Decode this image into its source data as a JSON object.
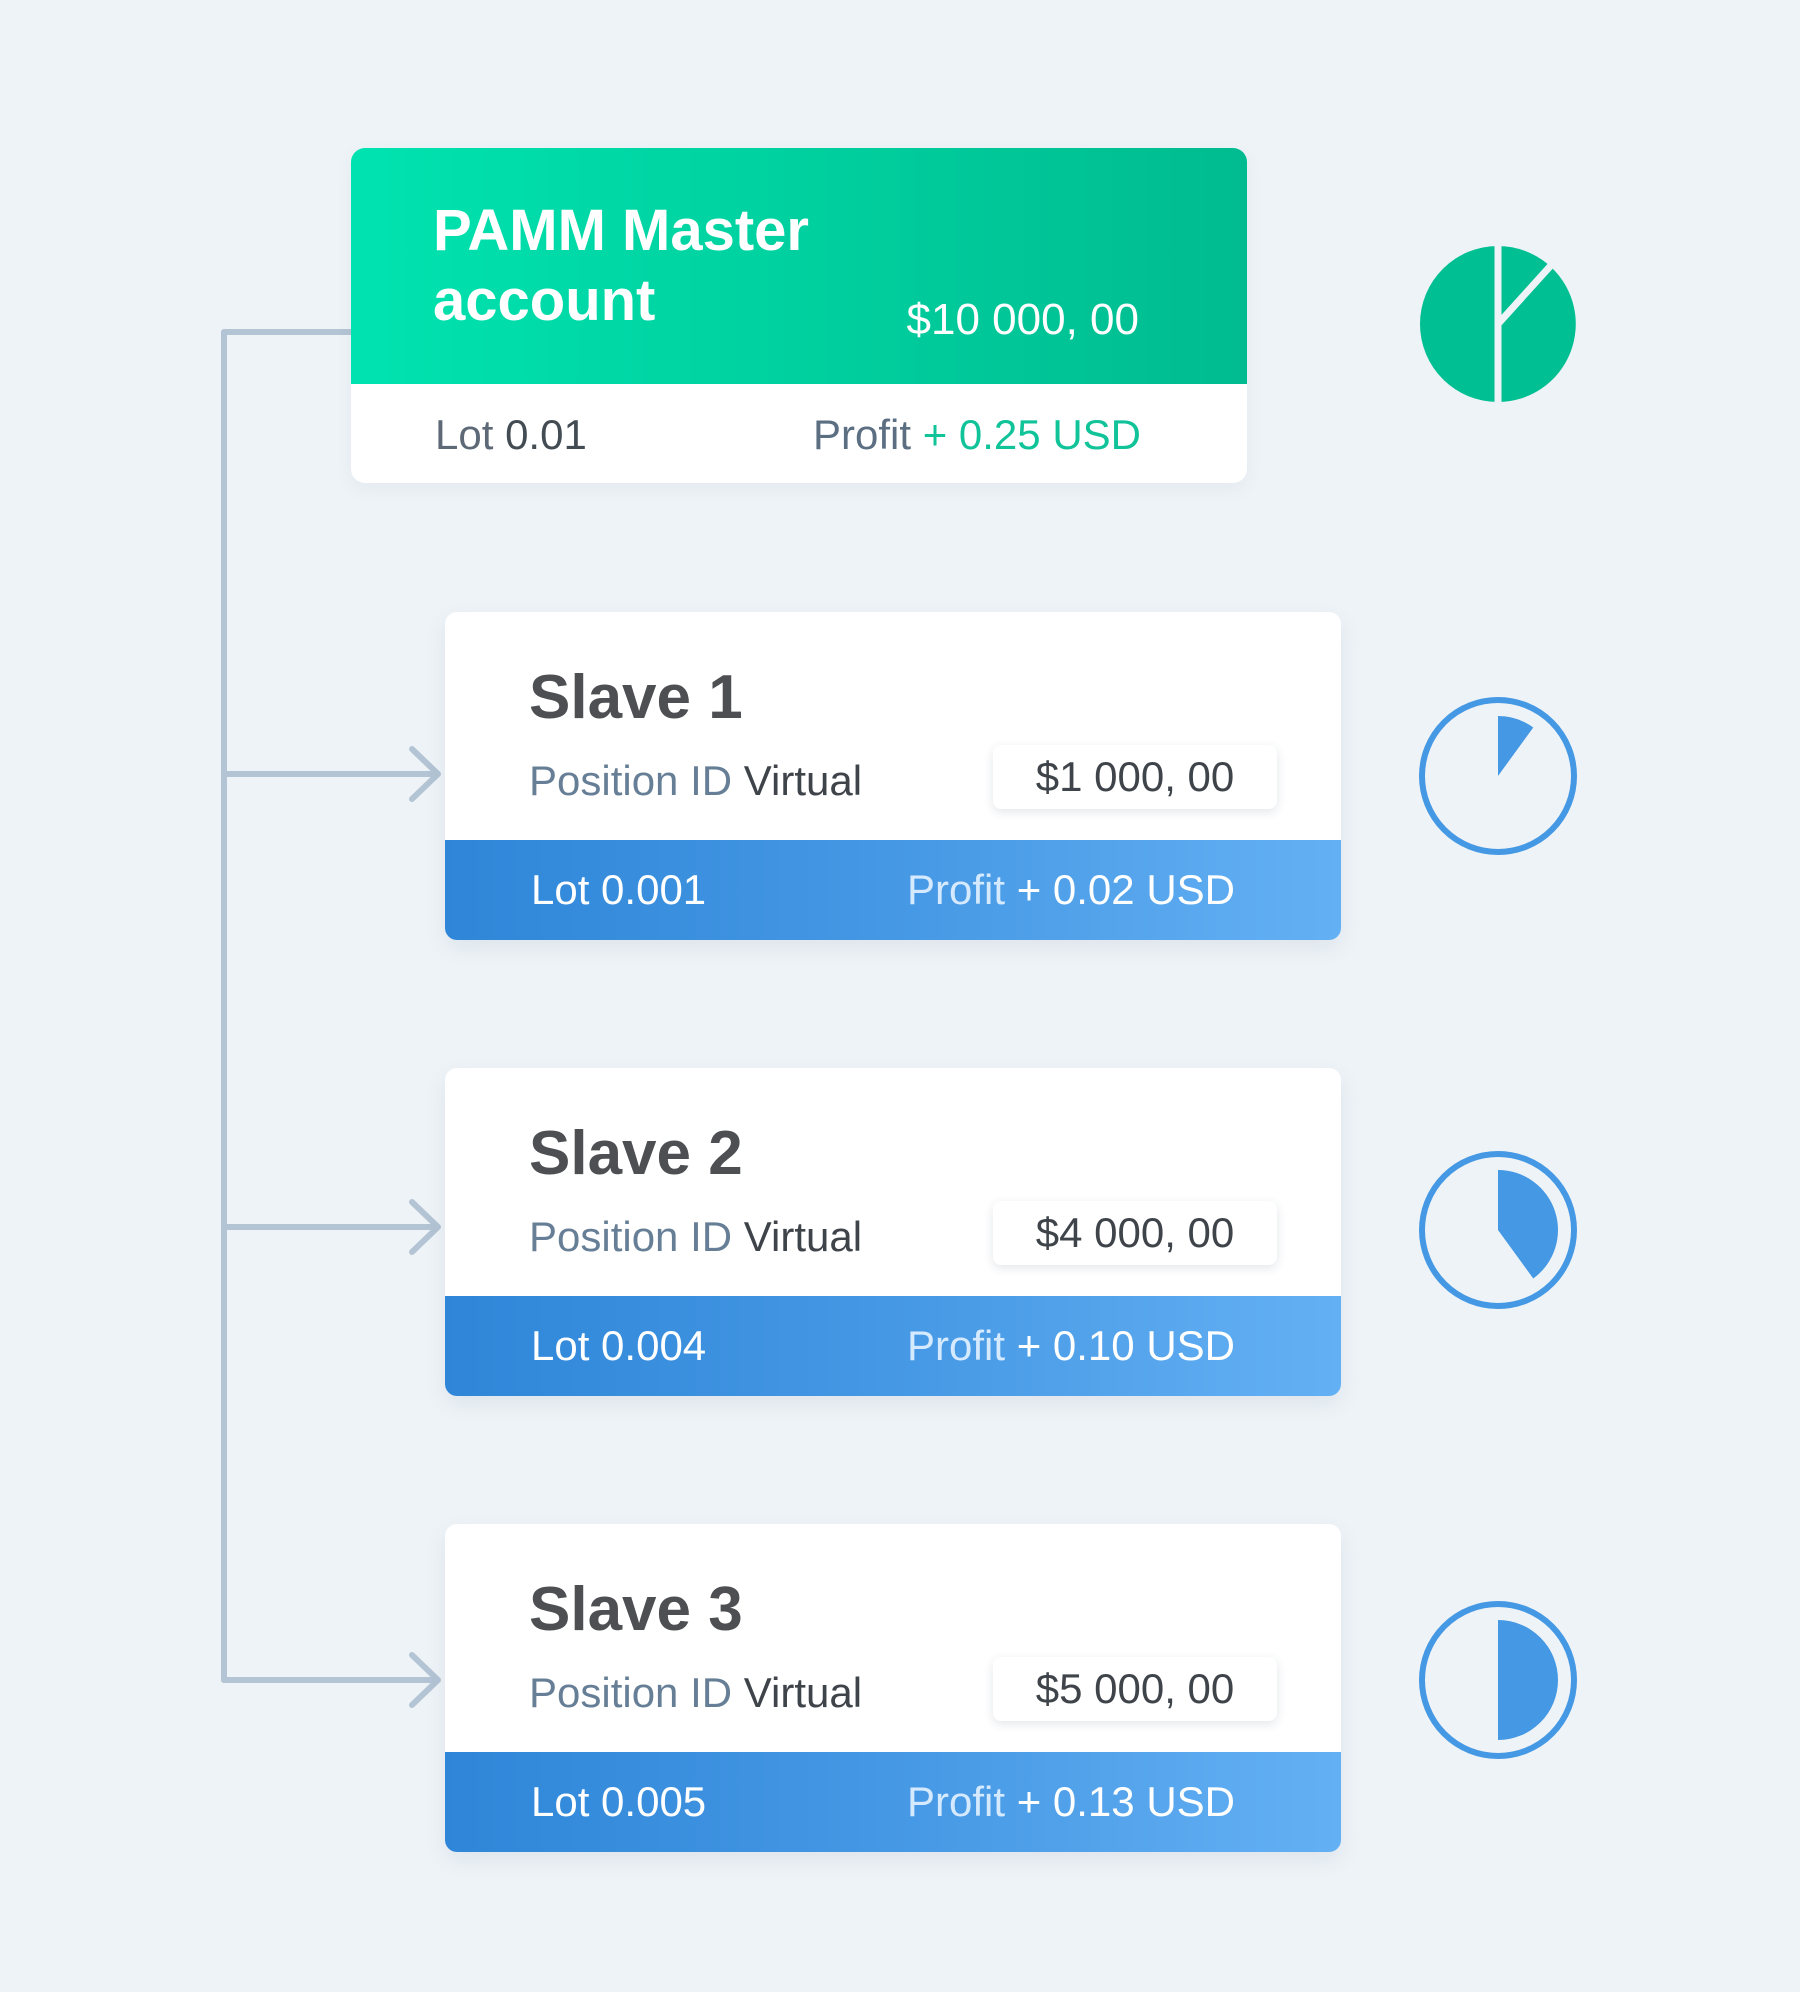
{
  "master": {
    "title": "PAMM Master account",
    "amount": "$10 000, 00",
    "lot_label": "Lot",
    "lot_value": "0.01",
    "profit_label": "Profit",
    "profit_value": "+ 0.25 USD"
  },
  "slaves": [
    {
      "title": "Slave 1",
      "position_label": "Position ID",
      "position_value": "Virtual",
      "amount": "$1 000, 00",
      "lot": "Lot 0.001",
      "profit_label": "Profit",
      "profit_value": "+ 0.02 USD",
      "share": 0.1
    },
    {
      "title": "Slave 2",
      "position_label": "Position ID",
      "position_value": "Virtual",
      "amount": "$4 000, 00",
      "lot": "Lot 0.004",
      "profit_label": "Profit",
      "profit_value": "+ 0.10 USD",
      "share": 0.4
    },
    {
      "title": "Slave 3",
      "position_label": "Position ID",
      "position_value": "Virtual",
      "amount": "$5 000, 00",
      "lot": "Lot 0.005",
      "profit_label": "Profit",
      "profit_value": "+ 0.13 USD",
      "share": 0.5
    }
  ],
  "colors": {
    "background": "#eef3f7",
    "master_accent": "#00c79a",
    "slave_accent": "#4598e4",
    "connector": "#b3c4d4"
  },
  "icons": {
    "master": "pie-chart-split-icon",
    "slaves": [
      "share-10-percent-icon",
      "share-40-percent-icon",
      "share-50-percent-icon"
    ]
  }
}
